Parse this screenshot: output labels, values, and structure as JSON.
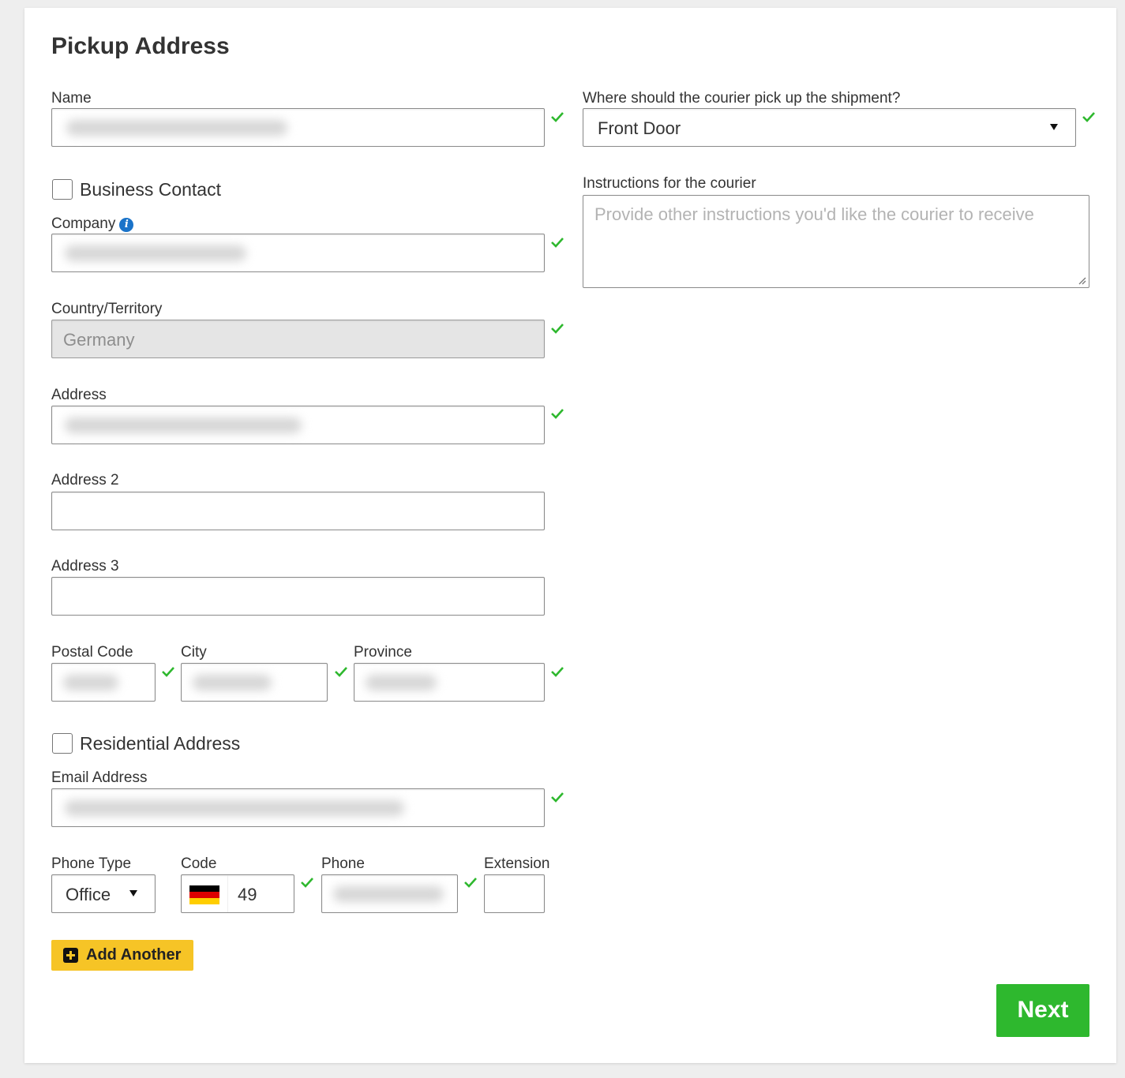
{
  "page": {
    "title": "Pickup Address"
  },
  "left": {
    "name": {
      "label": "Name"
    },
    "business_contact": {
      "label": "Business Contact",
      "checked": false
    },
    "company": {
      "label": "Company",
      "info_icon": "info-icon"
    },
    "country": {
      "label": "Country/Territory",
      "value": "Germany"
    },
    "address": {
      "label": "Address"
    },
    "address2": {
      "label": "Address 2",
      "value": ""
    },
    "address3": {
      "label": "Address 3",
      "value": ""
    },
    "postal_code": {
      "label": "Postal Code"
    },
    "city": {
      "label": "City"
    },
    "province": {
      "label": "Province"
    },
    "residential": {
      "label": "Residential Address",
      "checked": false
    },
    "email": {
      "label": "Email Address"
    },
    "phone_type": {
      "label": "Phone Type",
      "value": "Office"
    },
    "code": {
      "label": "Code",
      "value": "49",
      "flag": "germany-flag"
    },
    "phone": {
      "label": "Phone"
    },
    "extension": {
      "label": "Extension",
      "value": ""
    },
    "add_another": {
      "label": "Add Another"
    }
  },
  "right": {
    "pickup_location": {
      "label": "Where should the courier pick up the shipment?",
      "value": "Front Door"
    },
    "instructions": {
      "label": "Instructions for the courier",
      "placeholder": "Provide other instructions you'd like the courier to receive"
    }
  },
  "footer": {
    "next_label": "Next"
  },
  "colors": {
    "check": "#2eb82e",
    "next_button": "#2eb82e",
    "add_button": "#f6c426",
    "info": "#1a73c9"
  }
}
